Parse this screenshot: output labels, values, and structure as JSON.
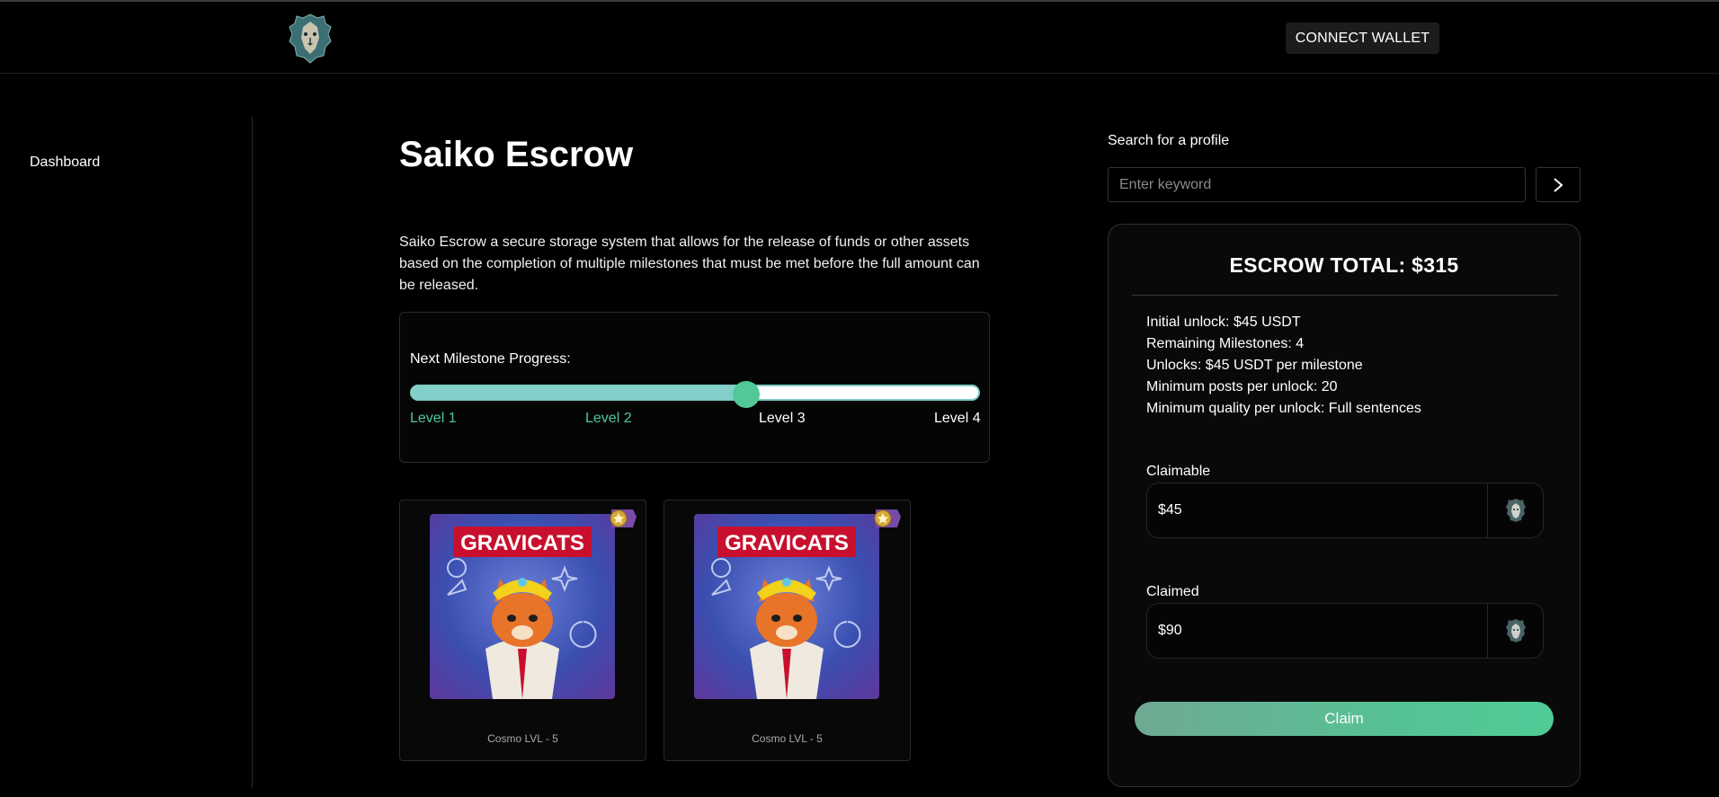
{
  "header": {
    "connect_label": "CONNECT WALLET"
  },
  "sidebar": {
    "items": [
      {
        "label": "Dashboard"
      }
    ]
  },
  "main": {
    "title": "Saiko Escrow",
    "description": "Saiko Escrow a secure storage system that allows for the release of funds or other assets based on the completion of multiple milestones that must be met before the full amount can be released.",
    "milestone": {
      "label": "Next Milestone Progress:",
      "progress": 0.59,
      "levels": [
        {
          "label": "Level 1",
          "reached": true
        },
        {
          "label": "Level 2",
          "reached": true
        },
        {
          "label": "Level 3",
          "reached": false
        },
        {
          "label": "Level 4",
          "reached": false
        }
      ]
    },
    "nfts": [
      {
        "image_text": "GRAVICATS",
        "caption": "Cosmo LVL - 5"
      },
      {
        "image_text": "GRAVICATS",
        "caption": "Cosmo LVL - 5"
      }
    ]
  },
  "search": {
    "label": "Search for a profile",
    "placeholder": "Enter keyword",
    "value": ""
  },
  "escrow": {
    "title": "ESCROW TOTAL: $315",
    "info": [
      "Initial unlock: $45 USDT",
      "Remaining Milestones: 4",
      "Unlocks: $45 USDT per milestone",
      "Minimum posts per unlock: 20",
      "Minimum quality per unlock: Full sentences"
    ],
    "claimable_label": "Claimable",
    "claimable_value": "$45",
    "claimed_label": "Claimed",
    "claimed_value": "$90",
    "claim_label": "Claim"
  },
  "colors": {
    "accent": "#50c997",
    "track": "#83cfc9",
    "background": "#000000"
  },
  "icons": [
    "lion-logo-icon",
    "chevron-right-icon",
    "medal-badge-icon",
    "lion-token-icon"
  ]
}
